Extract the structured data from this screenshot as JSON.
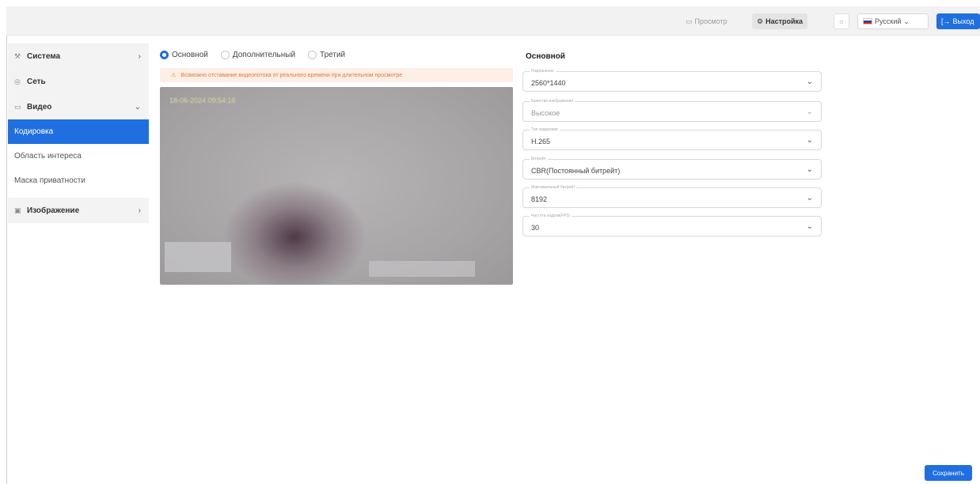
{
  "topbar": {
    "preview_label": "Просмотр",
    "settings_label": "Настройка",
    "language": "Русский",
    "exit_label": "Выход"
  },
  "sidebar": {
    "system": "Система",
    "network": "Сеть",
    "video": "Видео",
    "encoding": "Кодировка",
    "roi": "Область интереса",
    "privacy_mask": "Маска приватности",
    "image": "Изображение"
  },
  "tabs": [
    "Основной",
    "Дополнительный",
    "Третий"
  ],
  "warning": "Возможно отставание видеопотока от реального времени при длительном просмотре",
  "video": {
    "timestamp": "18-06-2024 09:54:16"
  },
  "form": {
    "title": "Основной",
    "fields": [
      {
        "label": "Разрешение",
        "value": "2560*1440",
        "disabled": false
      },
      {
        "label": "Качество изображения",
        "value": "Высокое",
        "disabled": true
      },
      {
        "label": "Тип кодировки",
        "value": "H.265",
        "disabled": false
      },
      {
        "label": "Битрейт",
        "value": "CBR(Постоянный битрейт)",
        "disabled": false
      },
      {
        "label": "Максимальный битрейт",
        "value": "8192",
        "disabled": false
      },
      {
        "label": "Частота кадров(FPS)",
        "value": "30",
        "disabled": false
      }
    ]
  },
  "save_label": "Сохранить",
  "colors": {
    "accent": "#1f6fe0",
    "warning_bg": "#fdeee6",
    "warning_text": "#e07a3a"
  }
}
